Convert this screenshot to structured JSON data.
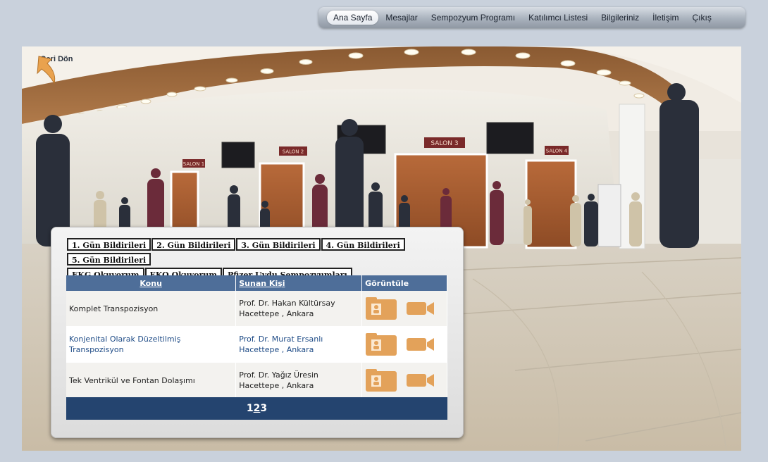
{
  "nav": {
    "items": [
      {
        "label": "Ana Sayfa",
        "active": true
      },
      {
        "label": "Mesajlar"
      },
      {
        "label": "Sempozyum Programı"
      },
      {
        "label": "Katılımcı Listesi"
      },
      {
        "label": "Bilgileriniz"
      },
      {
        "label": "İletişim"
      },
      {
        "label": "Çıkış"
      }
    ]
  },
  "scene": {
    "back_label": "Geri Dön",
    "signs": [
      "SALON 1",
      "SALON 2",
      "SALON 3",
      "SALON 4"
    ]
  },
  "tabs": [
    "1. Gün Bildirileri",
    "2. Gün Bildirileri",
    "3. Gün Bildirileri",
    "4. Gün Bildirileri",
    "5. Gün Bildirileri",
    "EKG Okuyorum",
    "EKO Okuyorum",
    "Pfizer Uydu Sempozyumları"
  ],
  "table": {
    "headers": {
      "topic": "Konu",
      "presenter": "Sunan Kişi",
      "view": "Görüntüle"
    },
    "rows": [
      {
        "topic": "Komplet Transpozisyon",
        "presenter": "Prof. Dr. Hakan Kültürsay",
        "place": "Hacettepe , Ankara"
      },
      {
        "topic": "Konjenital Olarak Düzeltilmiş Transpozisyon",
        "presenter": "Prof. Dr. Murat Ersanlı",
        "place": "Hacettepe , Ankara"
      },
      {
        "topic": "Tek Ventrikül ve Fontan Dolaşımı",
        "presenter": "Prof. Dr. Yağız Üresin",
        "place": "Hacettepe , Ankara"
      }
    ]
  },
  "pager": {
    "pages": [
      "1",
      "2",
      "3"
    ],
    "current": "2"
  },
  "colors": {
    "header": "#4e6e99",
    "pager": "#24446f",
    "icon": "#e3a25a"
  },
  "icons": {
    "back": "back-arrow-icon",
    "document": "document-person-icon",
    "video": "video-camera-icon"
  }
}
